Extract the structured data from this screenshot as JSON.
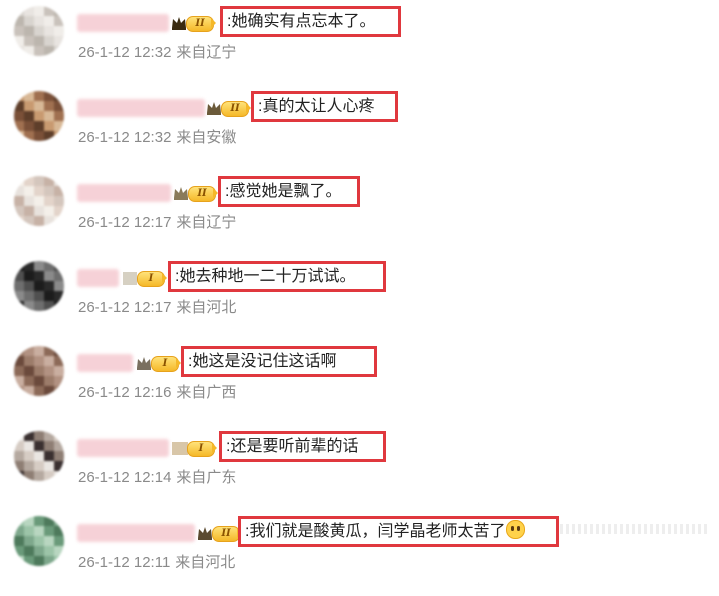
{
  "comments": [
    {
      "badge_level": "II",
      "text": ":她确实有点忘本了。",
      "time": "26-1-12 12:32",
      "location": "来自辽宁",
      "has_emoji": false,
      "emoji_name": "",
      "avatar_colors": [
        "#d8d4cf",
        "#c9c2bb",
        "#e8e4e0",
        "#bcb6ae",
        "#f0ede9"
      ]
    },
    {
      "badge_level": "II",
      "text": ":真的太让人心疼",
      "time": "26-1-12 12:32",
      "location": "来自安徽",
      "has_emoji": false,
      "emoji_name": "",
      "avatar_colors": [
        "#a07050",
        "#c89a70",
        "#7a5038",
        "#d8b896",
        "#5e3e2a"
      ]
    },
    {
      "badge_level": "II",
      "text": ":感觉她是飘了。",
      "time": "26-1-12 12:17",
      "location": "来自辽宁",
      "has_emoji": false,
      "emoji_name": "",
      "avatar_colors": [
        "#e8e2dd",
        "#d4c6bd",
        "#f4efe9",
        "#c7b2a6",
        "#e3d4ca"
      ]
    },
    {
      "badge_level": "I",
      "text": ":她去种地一二十万试试。",
      "time": "26-1-12 12:17",
      "location": "来自河北",
      "has_emoji": false,
      "emoji_name": "",
      "avatar_colors": [
        "#2a2a2a",
        "#505050",
        "#8a8a8a",
        "#1c1c1c",
        "#6e6e6e"
      ]
    },
    {
      "badge_level": "I",
      "text": ":她这是没记住这话啊",
      "time": "26-1-12 12:16",
      "location": "来自广西",
      "has_emoji": false,
      "emoji_name": "",
      "avatar_colors": [
        "#8c6a58",
        "#b29282",
        "#6b4a3c",
        "#c9aea0",
        "#9c7c6a"
      ]
    },
    {
      "badge_level": "I",
      "text": ":还是要听前辈的话",
      "time": "26-1-12 12:14",
      "location": "来自广东",
      "has_emoji": false,
      "emoji_name": "",
      "avatar_colors": [
        "#eae6e2",
        "#b5a9a0",
        "#3a3030",
        "#d6ccc4",
        "#8e7e74"
      ]
    },
    {
      "badge_level": "II",
      "text": ":我们就是酸黄瓜，闫学晶老师太苦了",
      "time": "26-1-12 12:11",
      "location": "来自河北",
      "has_emoji": true,
      "emoji_name": "crying-face-emoji",
      "avatar_colors": [
        "#6a9a7a",
        "#9cc4a8",
        "#4e7a5c",
        "#b8d6c0",
        "#7ea88c"
      ]
    }
  ],
  "colors": {
    "highlight_border": "#e0383e",
    "meta_text": "#8a8a8a",
    "comment_text": "#222222",
    "badge_gold": "#f5b829",
    "username_blur": "#f6cdd3"
  },
  "icons": {
    "crown": "crown-icon",
    "level_badge": "level-badge-icon"
  }
}
